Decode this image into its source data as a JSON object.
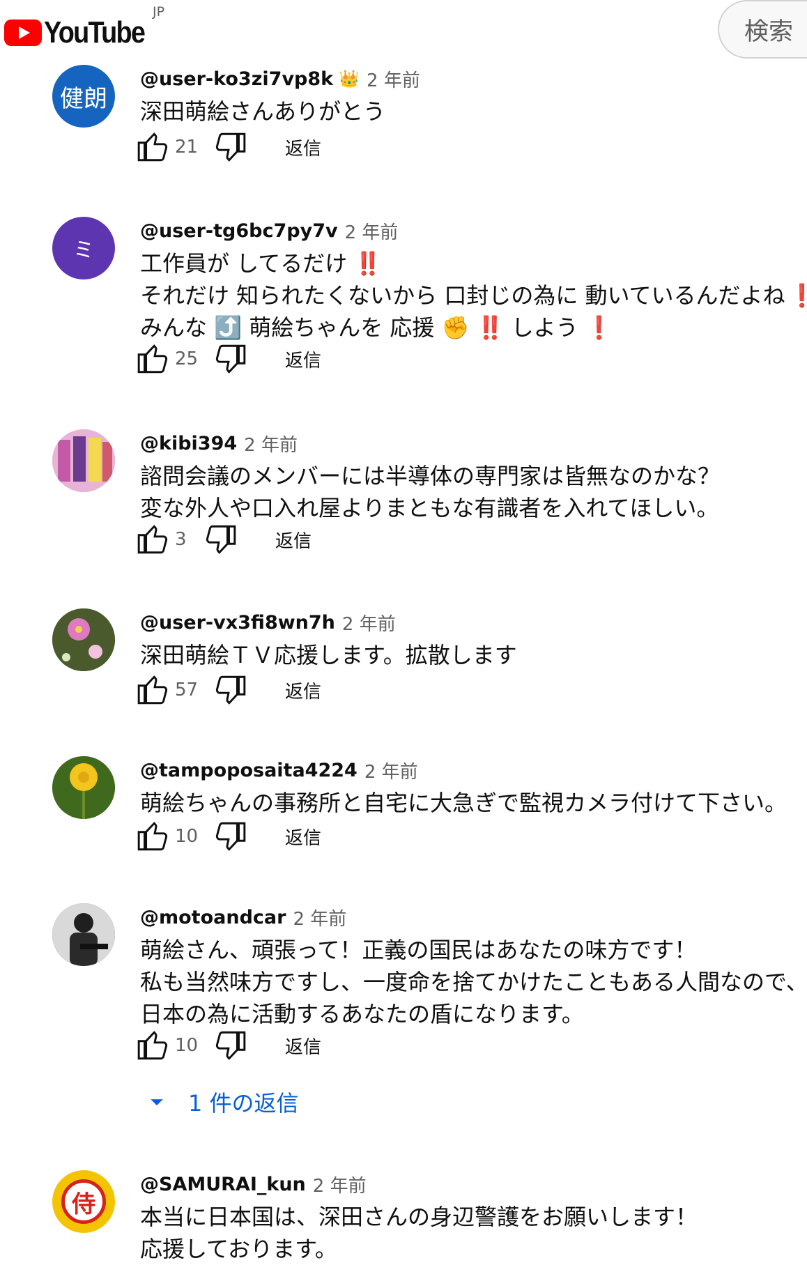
{
  "header": {
    "logo_text": "YouTube",
    "region": "JP",
    "search_label": "検索",
    "brand_color": "#ff0000"
  },
  "comments": [
    {
      "author": "@user-ko3zi7vp8k",
      "badge": "👑",
      "time": "2 年前",
      "lines": [
        "深田萌絵さんありがとう"
      ],
      "likes": "21",
      "reply_label": "返信",
      "avatar": {
        "type": "text",
        "text": "健朗",
        "bg": "#1565c0"
      }
    },
    {
      "author": "@user-tg6bc7py7v",
      "time": "2 年前",
      "lines": [
        "工作員が してるだけ ‼️",
        "それだけ 知られたくないから 口封じの為に 動いているんだよね ‼️",
        "みんな ⤴️ 萌絵ちゃんを 応援 ✊ ‼️ しよう ❗"
      ],
      "likes": "25",
      "reply_label": "返信",
      "avatar": {
        "type": "text",
        "text": "ミ",
        "bg": "#5e35b1"
      }
    },
    {
      "author": "@kibi394",
      "time": "2 年前",
      "lines": [
        "諮問会議のメンバーには半導体の専門家は皆無なのかな？",
        "変な外人や口入れ屋よりまともな有識者を入れてほしい。"
      ],
      "likes": "3",
      "reply_label": "返信",
      "avatar": {
        "type": "image",
        "bg": "#e8b4d6"
      }
    },
    {
      "author": "@user-vx3fi8wn7h",
      "time": "2 年前",
      "lines": [
        "深田萌絵ＴＶ応援します。拡散します"
      ],
      "likes": "57",
      "reply_label": "返信",
      "avatar": {
        "type": "image",
        "bg": "#4a5a2c"
      }
    },
    {
      "author": "@tampoposaita4224",
      "time": "2 年前",
      "lines": [
        "萌絵ちゃんの事務所と自宅に大急ぎで監視カメラ付けて下さい。"
      ],
      "likes": "10",
      "reply_label": "返信",
      "avatar": {
        "type": "image",
        "bg": "#3f6a1e"
      }
    },
    {
      "author": "@motoandcar",
      "time": "2 年前",
      "lines": [
        "萌絵さん、頑張って！正義の国民はあなたの味方です！",
        "私も当然味方ですし、一度命を捨てかけたこともある人間なので、",
        "日本の為に活動するあなたの盾になります。"
      ],
      "likes": "10",
      "reply_label": "返信",
      "replies": "1 件の返信",
      "avatar": {
        "type": "image",
        "bg": "#3a3a3a"
      }
    },
    {
      "author": "@SAMURAI_kun",
      "time": "2 年前",
      "lines": [
        "本当に日本国は、深田さんの身辺警護をお願いします！",
        "応援しております。"
      ],
      "avatar": {
        "type": "samurai",
        "text": "侍",
        "bg": "#f5c400"
      }
    }
  ]
}
